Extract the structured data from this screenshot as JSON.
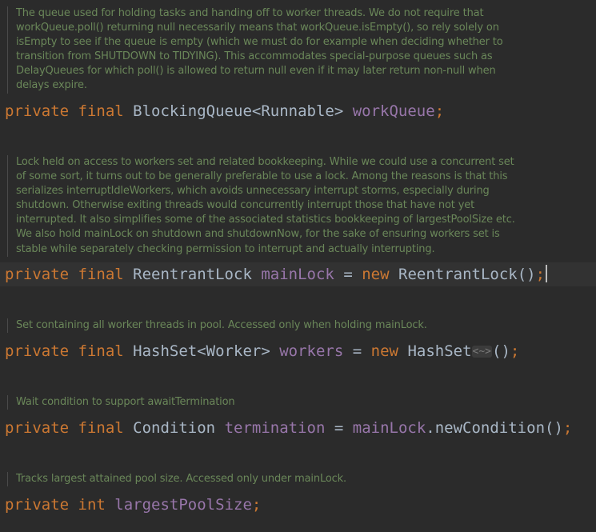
{
  "docs": [
    {
      "lines": [
        "The queue used for holding tasks and handing off to worker threads. We do not require that",
        "workQueue.poll() returning null necessarily means that workQueue.isEmpty(), so rely solely on",
        "isEmpty to see if the queue is empty (which we must do for example when deciding whether to",
        "transition from SHUTDOWN to TIDYING). This accommodates special-purpose queues such as",
        "DelayQueues for which poll() is allowed to return null even if it may later return non-null when",
        "delays expire."
      ]
    },
    {
      "lines": [
        "Lock held on access to workers set and related bookkeeping. While we could use a concurrent set",
        "of some sort, it turns out to be generally preferable to use a lock. Among the reasons is that this",
        "serializes interruptIdleWorkers, which avoids unnecessary interrupt storms, especially during",
        "shutdown. Otherwise exiting threads would concurrently interrupt those that have not yet",
        "interrupted. It also simplifies some of the associated statistics bookkeeping of largestPoolSize etc.",
        "We also hold mainLock on shutdown and shutdownNow, for the sake of ensuring workers set is",
        "stable while separately checking permission to interrupt and actually interrupting."
      ]
    },
    {
      "lines": [
        "Set containing all worker threads in pool. Accessed only when holding mainLock."
      ]
    },
    {
      "lines": [
        "Wait condition to support awaitTermination"
      ]
    },
    {
      "lines": [
        "Tracks largest attained pool size. Accessed only under mainLock."
      ]
    }
  ],
  "code": [
    {
      "modifiers": "private final",
      "type": "BlockingQueue<Runnable>",
      "field": "workQueue",
      "semicolon": ";"
    },
    {
      "modifiers": "private final",
      "type": "ReentrantLock",
      "field": "mainLock",
      "equals": "=",
      "new_kw": "new",
      "ctor": "ReentrantLock()",
      "semicolon": ";"
    },
    {
      "modifiers": "private final",
      "type": "HashSet<Worker>",
      "field": "workers",
      "equals": "=",
      "new_kw": "new",
      "ctor_name": "HashSet",
      "diamond_fold": "<~>",
      "ctor_parens": "()",
      "semicolon": ";"
    },
    {
      "modifiers": "private final",
      "type": "Condition",
      "field": "termination",
      "equals": "=",
      "call_target": "mainLock",
      "call_method": ".newCondition()",
      "semicolon": ";"
    },
    {
      "modifiers": "private int",
      "field": "largestPoolSize",
      "semicolon": ";"
    }
  ],
  "colors": {
    "background": "#2b2b2b",
    "current_line": "#323232",
    "keyword": "#cc7832",
    "field": "#9876aa",
    "plain": "#a9b7c6",
    "doc_comment": "#6a8759"
  }
}
